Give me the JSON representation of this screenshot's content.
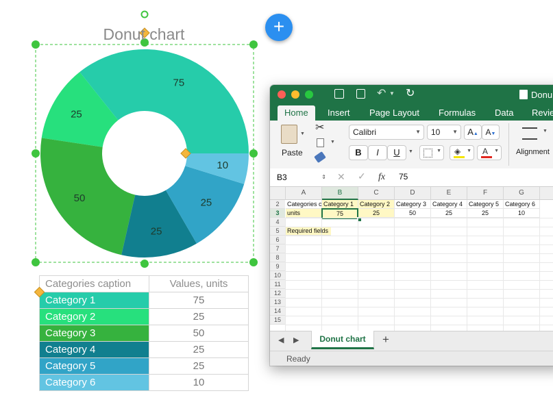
{
  "chart": {
    "title": "Donut chart"
  },
  "chart_data": {
    "type": "donut",
    "title": "Donut chart",
    "categories": [
      "Category 1",
      "Category 2",
      "Category 3",
      "Category 4",
      "Category 5",
      "Category 6"
    ],
    "values": [
      75,
      25,
      50,
      25,
      25,
      10
    ],
    "colors": [
      "#26ccaa",
      "#27e07d",
      "#36b23e",
      "#117f8f",
      "#31a4c7",
      "#62c4e2"
    ],
    "start_angle_deg": 0,
    "direction": "counterclockwise",
    "legend": "table-below"
  },
  "data_table": {
    "header_category": "Categories caption",
    "header_value": "Values, units",
    "rows": [
      {
        "category": "Category 1",
        "value": "75",
        "color": "#26ccaa"
      },
      {
        "category": "Category 2",
        "value": "25",
        "color": "#27e07d"
      },
      {
        "category": "Category 3",
        "value": "50",
        "color": "#36b23e"
      },
      {
        "category": "Category 4",
        "value": "25",
        "color": "#117f8f"
      },
      {
        "category": "Category 5",
        "value": "25",
        "color": "#31a4c7"
      },
      {
        "category": "Category 6",
        "value": "10",
        "color": "#62c4e2"
      }
    ]
  },
  "add_button": {
    "label": "+"
  },
  "excel": {
    "window_title": "Donu",
    "tabs": [
      "Home",
      "Insert",
      "Page Layout",
      "Formulas",
      "Data",
      "Revie"
    ],
    "active_tab": "Home",
    "ribbon": {
      "paste_label": "Paste",
      "font_name": "Calibri",
      "font_size": "10",
      "bold": "B",
      "italic": "I",
      "underline": "U",
      "grow_font": "A",
      "shrink_font": "A",
      "alignment_label": "Alignment"
    },
    "formula_bar": {
      "name_box": "B3",
      "fx": "fx",
      "value": "75"
    },
    "columns": [
      "A",
      "B",
      "C",
      "D",
      "E",
      "F",
      "G"
    ],
    "selected_column": "B",
    "rows": [
      "2",
      "3",
      "4",
      "5",
      "6",
      "7",
      "8",
      "9",
      "10",
      "11",
      "12",
      "13",
      "14",
      "15"
    ],
    "selected_row": "3",
    "row2": [
      "Categories c",
      "Category 1",
      "Category 2",
      "Category 3",
      "Category 4",
      "Category 5",
      "Category 6"
    ],
    "row3": [
      "units",
      "75",
      "25",
      "50",
      "25",
      "25",
      "10"
    ],
    "row5_note": "Required fields",
    "sheet_tab": "Donut chart",
    "add_sheet": "+",
    "status": "Ready"
  }
}
